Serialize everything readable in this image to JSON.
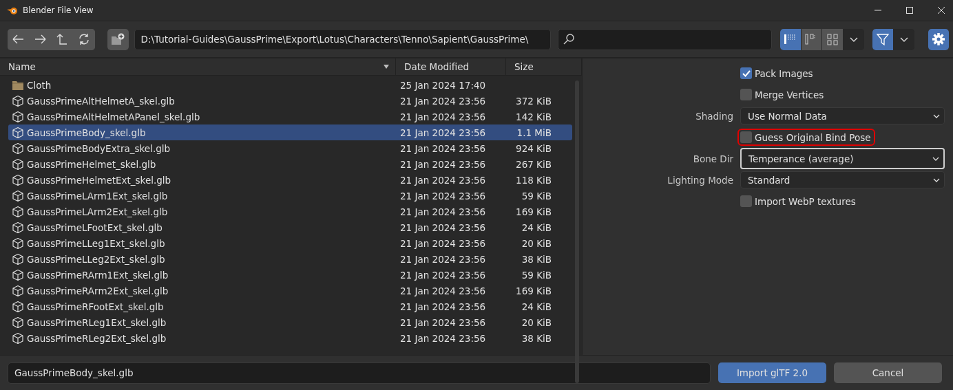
{
  "window": {
    "title": "Blender File View"
  },
  "toolbar": {
    "path": "D:\\Tutorial-Guides\\GaussPrime\\Export\\Lotus\\Characters\\Tenno\\Sapient\\GaussPrime\\",
    "view_modes": [
      {
        "kind": "vertical",
        "selected": true
      },
      {
        "kind": "horizontal",
        "selected": false
      },
      {
        "kind": "thumbnails",
        "selected": false
      }
    ],
    "filter": {
      "selected": true
    },
    "settings": {
      "selected": true
    }
  },
  "table": {
    "columns": [
      "Name",
      "Date Modified",
      "Size"
    ],
    "rows": [
      {
        "kind": "folder",
        "name": "Cloth",
        "date": "25 Jan 2024 17:40",
        "size": "",
        "selected": false
      },
      {
        "kind": "file",
        "name": "GaussPrimeAltHelmetA_skel.glb",
        "date": "21 Jan 2024 23:56",
        "size": "372 KiB",
        "selected": false
      },
      {
        "kind": "file",
        "name": "GaussPrimeAltHelmetAPanel_skel.glb",
        "date": "21 Jan 2024 23:56",
        "size": "142 KiB",
        "selected": false
      },
      {
        "kind": "file",
        "name": "GaussPrimeBody_skel.glb",
        "date": "21 Jan 2024 23:56",
        "size": "1.1 MiB",
        "selected": true
      },
      {
        "kind": "file",
        "name": "GaussPrimeBodyExtra_skel.glb",
        "date": "21 Jan 2024 23:56",
        "size": "924 KiB",
        "selected": false
      },
      {
        "kind": "file",
        "name": "GaussPrimeHelmet_skel.glb",
        "date": "21 Jan 2024 23:56",
        "size": "267 KiB",
        "selected": false
      },
      {
        "kind": "file",
        "name": "GaussPrimeHelmetExt_skel.glb",
        "date": "21 Jan 2024 23:56",
        "size": "118 KiB",
        "selected": false
      },
      {
        "kind": "file",
        "name": "GaussPrimeLArm1Ext_skel.glb",
        "date": "21 Jan 2024 23:56",
        "size": "59 KiB",
        "selected": false
      },
      {
        "kind": "file",
        "name": "GaussPrimeLArm2Ext_skel.glb",
        "date": "21 Jan 2024 23:56",
        "size": "169 KiB",
        "selected": false
      },
      {
        "kind": "file",
        "name": "GaussPrimeLFootExt_skel.glb",
        "date": "21 Jan 2024 23:56",
        "size": "24 KiB",
        "selected": false
      },
      {
        "kind": "file",
        "name": "GaussPrimeLLeg1Ext_skel.glb",
        "date": "21 Jan 2024 23:56",
        "size": "20 KiB",
        "selected": false
      },
      {
        "kind": "file",
        "name": "GaussPrimeLLeg2Ext_skel.glb",
        "date": "21 Jan 2024 23:56",
        "size": "38 KiB",
        "selected": false
      },
      {
        "kind": "file",
        "name": "GaussPrimeRArm1Ext_skel.glb",
        "date": "21 Jan 2024 23:56",
        "size": "59 KiB",
        "selected": false
      },
      {
        "kind": "file",
        "name": "GaussPrimeRArm2Ext_skel.glb",
        "date": "21 Jan 2024 23:56",
        "size": "169 KiB",
        "selected": false
      },
      {
        "kind": "file",
        "name": "GaussPrimeRFootExt_skel.glb",
        "date": "21 Jan 2024 23:56",
        "size": "24 KiB",
        "selected": false
      },
      {
        "kind": "file",
        "name": "GaussPrimeRLeg1Ext_skel.glb",
        "date": "21 Jan 2024 23:56",
        "size": "20 KiB",
        "selected": false
      },
      {
        "kind": "file",
        "name": "GaussPrimeRLeg2Ext_skel.glb",
        "date": "21 Jan 2024 23:56",
        "size": "38 KiB",
        "selected": false
      }
    ]
  },
  "options": [
    {
      "kind": "checkbox",
      "label": "Pack Images",
      "checked": true,
      "highlighted": false
    },
    {
      "kind": "checkbox",
      "label": "Merge Vertices",
      "checked": false,
      "highlighted": false
    },
    {
      "kind": "dropdown",
      "label": "Shading",
      "value": "Use Normal Data",
      "active": false
    },
    {
      "kind": "checkbox",
      "label": "Guess Original Bind Pose",
      "checked": false,
      "highlighted": true
    },
    {
      "kind": "dropdown",
      "label": "Bone Dir",
      "value": "Temperance (average)",
      "active": true
    },
    {
      "kind": "dropdown",
      "label": "Lighting Mode",
      "value": "Standard",
      "active": false
    },
    {
      "kind": "checkbox",
      "label": "Import WebP textures",
      "checked": false,
      "highlighted": false
    }
  ],
  "footer": {
    "filename": "GaussPrimeBody_skel.glb",
    "buttons": [
      {
        "kind": "primary",
        "label": "Import glTF 2.0"
      },
      {
        "kind": "normal",
        "label": "Cancel"
      }
    ]
  }
}
